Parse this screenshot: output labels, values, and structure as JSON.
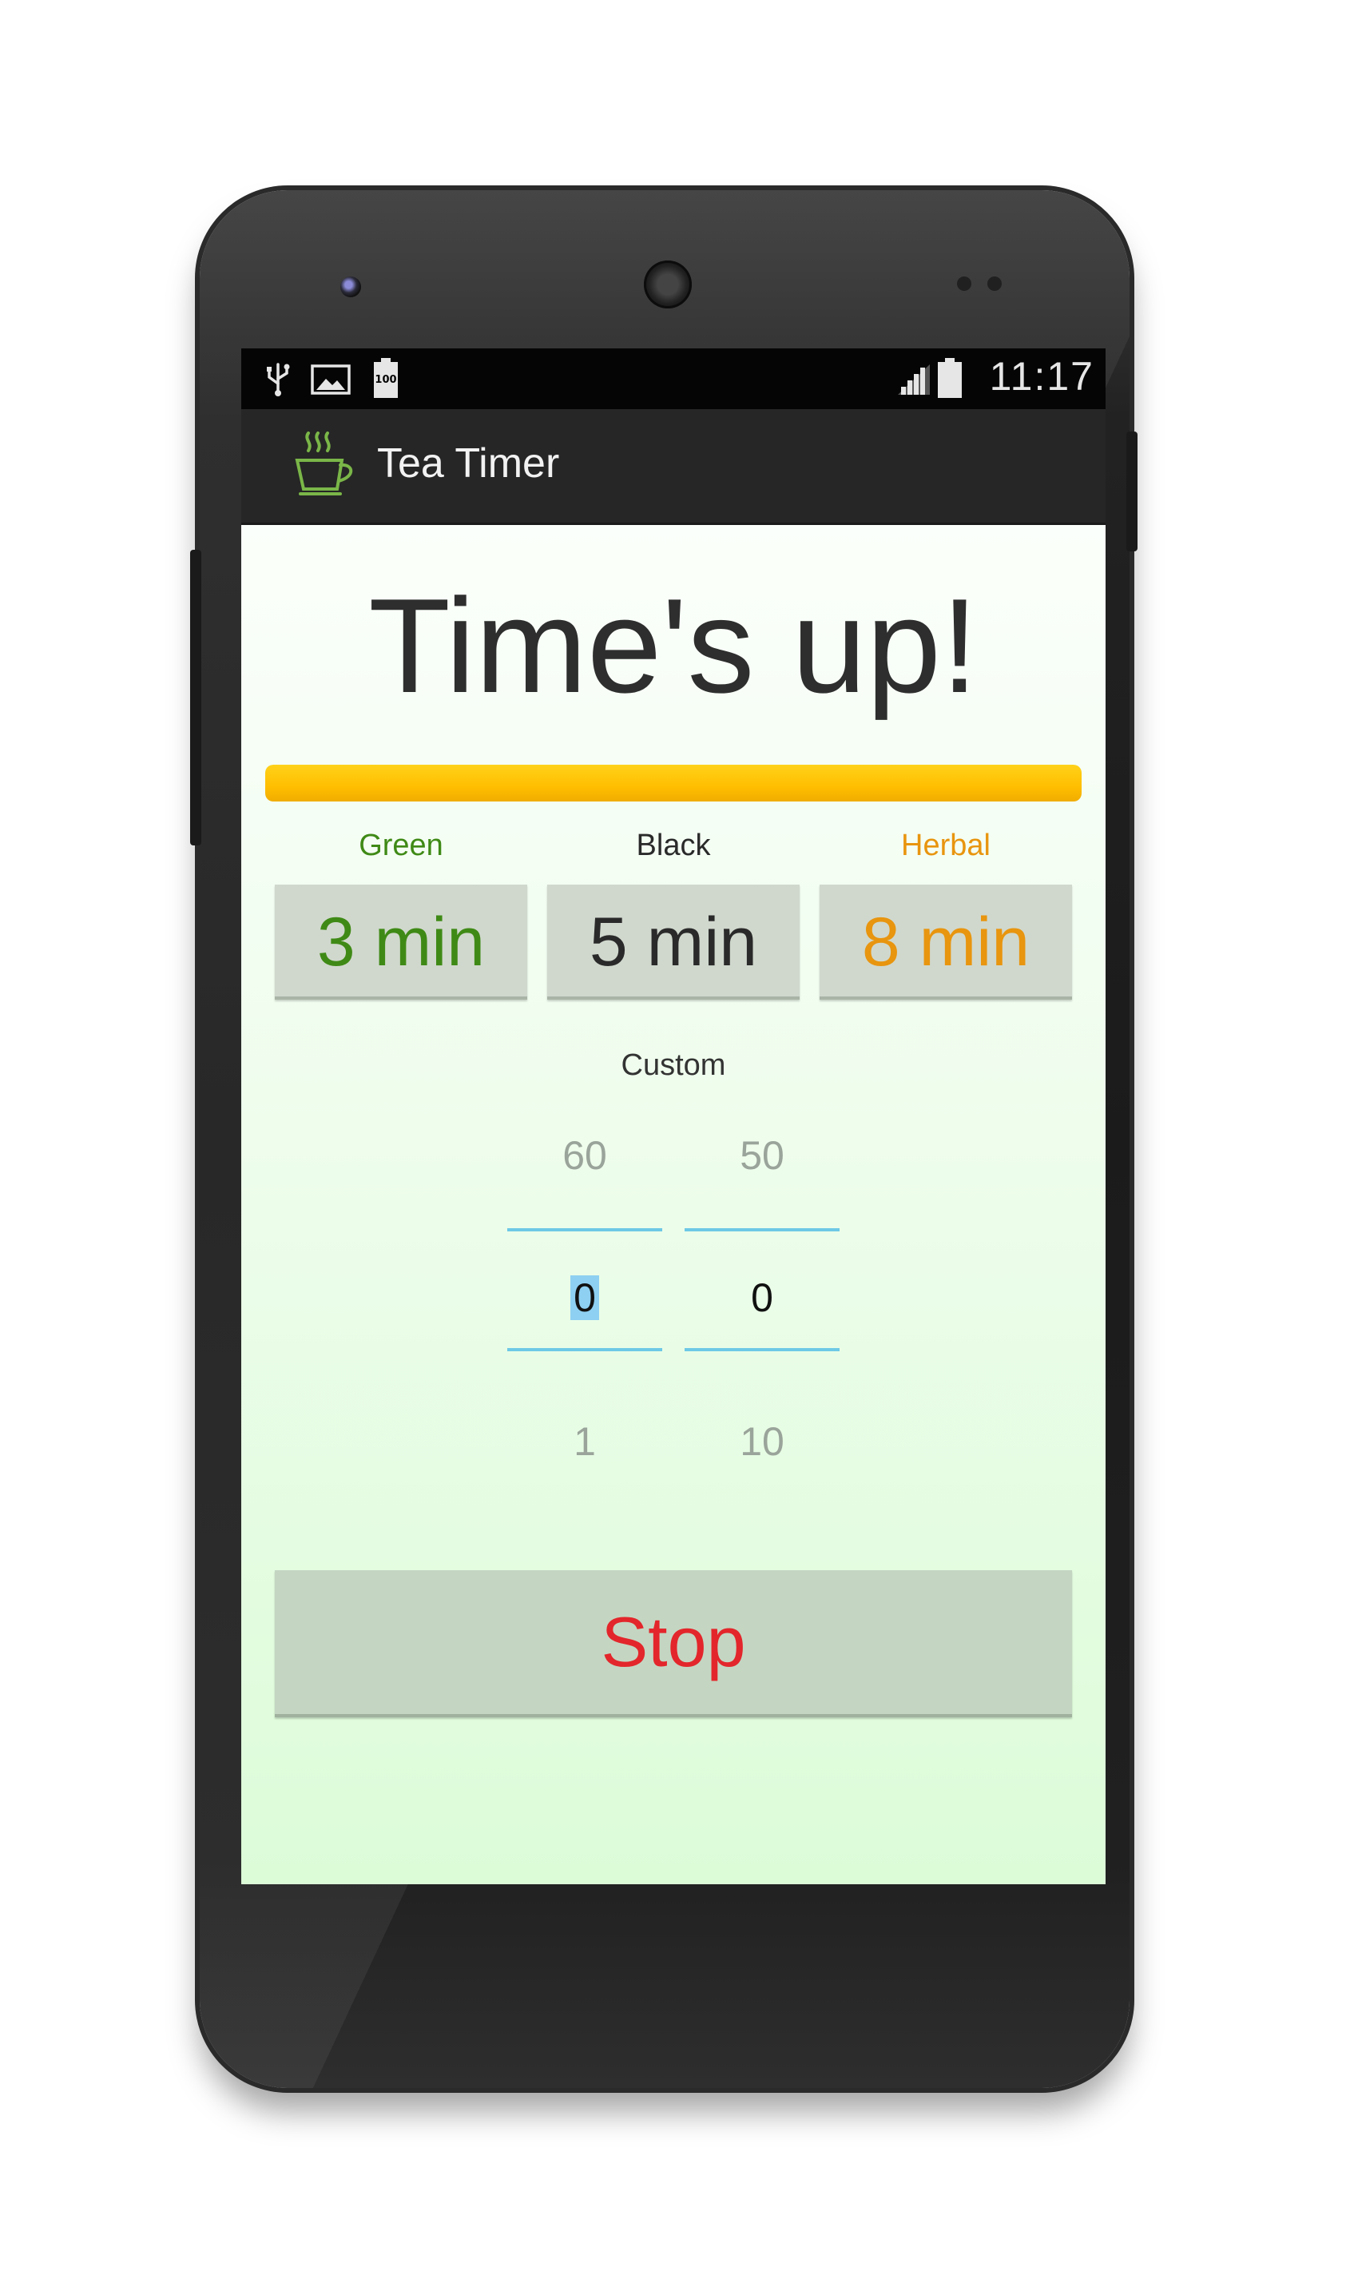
{
  "status_bar": {
    "time": "11:17",
    "battery_badge": "100",
    "left_icons": [
      "usb-icon",
      "image-icon",
      "battery-icon"
    ],
    "right_icons": [
      "signal-icon",
      "battery-icon"
    ]
  },
  "action_bar": {
    "title": "Tea Timer",
    "icon": "tea-cup-icon",
    "icon_color": "#7ab648"
  },
  "main": {
    "headline": "Time's up!",
    "progress_fraction": 1.0,
    "progress_color": "#ffbf00",
    "presets": [
      {
        "label": "Green",
        "button": "3 min",
        "color": "#3f8a16"
      },
      {
        "label": "Black",
        "button": "5 min",
        "color": "#2a2a2a"
      },
      {
        "label": "Herbal",
        "button": "8 min",
        "color": "#e8950f"
      }
    ],
    "custom": {
      "label": "Custom",
      "minutes": {
        "above": "60",
        "current": "0",
        "below": "1"
      },
      "seconds": {
        "above": "50",
        "current": "0",
        "below": "10"
      }
    },
    "stop_button": "Stop"
  }
}
